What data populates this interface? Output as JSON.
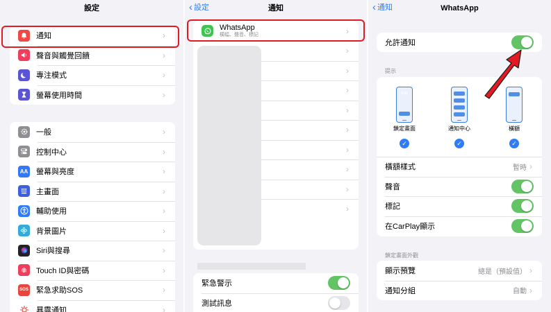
{
  "left": {
    "title": "設定",
    "group1": [
      {
        "label": "通知",
        "icon": "bell-icon",
        "color": "#ee4a43"
      },
      {
        "label": "聲音與觸覺回饋",
        "icon": "speaker-icon",
        "color": "#ee3e5c"
      },
      {
        "label": "專注模式",
        "icon": "moon-icon",
        "color": "#5b55d6"
      },
      {
        "label": "螢幕使用時間",
        "icon": "hourglass-icon",
        "color": "#5b55d6"
      }
    ],
    "group2": [
      {
        "label": "一般",
        "icon": "gear-icon",
        "color": "#8e8e93"
      },
      {
        "label": "控制中心",
        "icon": "switches-icon",
        "color": "#8e8e93"
      },
      {
        "label": "螢幕與亮度",
        "icon": "text-size-icon",
        "color": "#3478f6"
      },
      {
        "label": "主畫面",
        "icon": "home-grid-icon",
        "color": "#3d5fdd"
      },
      {
        "label": "輔助使用",
        "icon": "accessibility-icon",
        "color": "#2f7cf6"
      },
      {
        "label": "背景圖片",
        "icon": "flower-icon",
        "color": "#33aadc"
      },
      {
        "label": "Siri與搜尋",
        "icon": "siri-icon",
        "color": "#222222"
      },
      {
        "label": "Touch ID與密碼",
        "icon": "fingerprint-icon",
        "color": "#ee3e5c"
      },
      {
        "label": "緊急求助SOS",
        "icon": "sos-icon",
        "color": "#e8453c"
      },
      {
        "label": "暴露通知",
        "icon": "exposure-icon",
        "color": "#ffffff"
      }
    ]
  },
  "middle": {
    "back": "設定",
    "title": "通知",
    "whatsapp": {
      "name": "WhatsApp",
      "detail": "橫幅、聲音、標記",
      "color": "#3fc351"
    },
    "bottom": [
      {
        "label": "緊急警示",
        "on": true
      },
      {
        "label": "測試訊息",
        "on": false
      }
    ]
  },
  "right": {
    "back": "通知",
    "title": "WhatsApp",
    "allow": {
      "label": "允許通知",
      "on": true
    },
    "alerts_header": "提示",
    "styles": [
      {
        "caption": "鎖定畫面",
        "time": "9:41"
      },
      {
        "caption": "通知中心"
      },
      {
        "caption": "橫額"
      }
    ],
    "rows": [
      {
        "label": "橫額樣式",
        "value": "暫時",
        "type": "chevron"
      },
      {
        "label": "聲音",
        "type": "toggle",
        "on": true
      },
      {
        "label": "標記",
        "type": "toggle",
        "on": true
      },
      {
        "label": "在CarPlay顯示",
        "type": "toggle",
        "on": true
      }
    ],
    "lock_header": "鎖定畫面外觀",
    "lock_rows": [
      {
        "label": "顯示預覽",
        "value": "總是（預設值）"
      },
      {
        "label": "通知分組",
        "value": "自動"
      }
    ]
  },
  "colors": {
    "accent": "#2f7cf6",
    "highlight": "#e01b24",
    "toggle_on": "#63c466"
  }
}
